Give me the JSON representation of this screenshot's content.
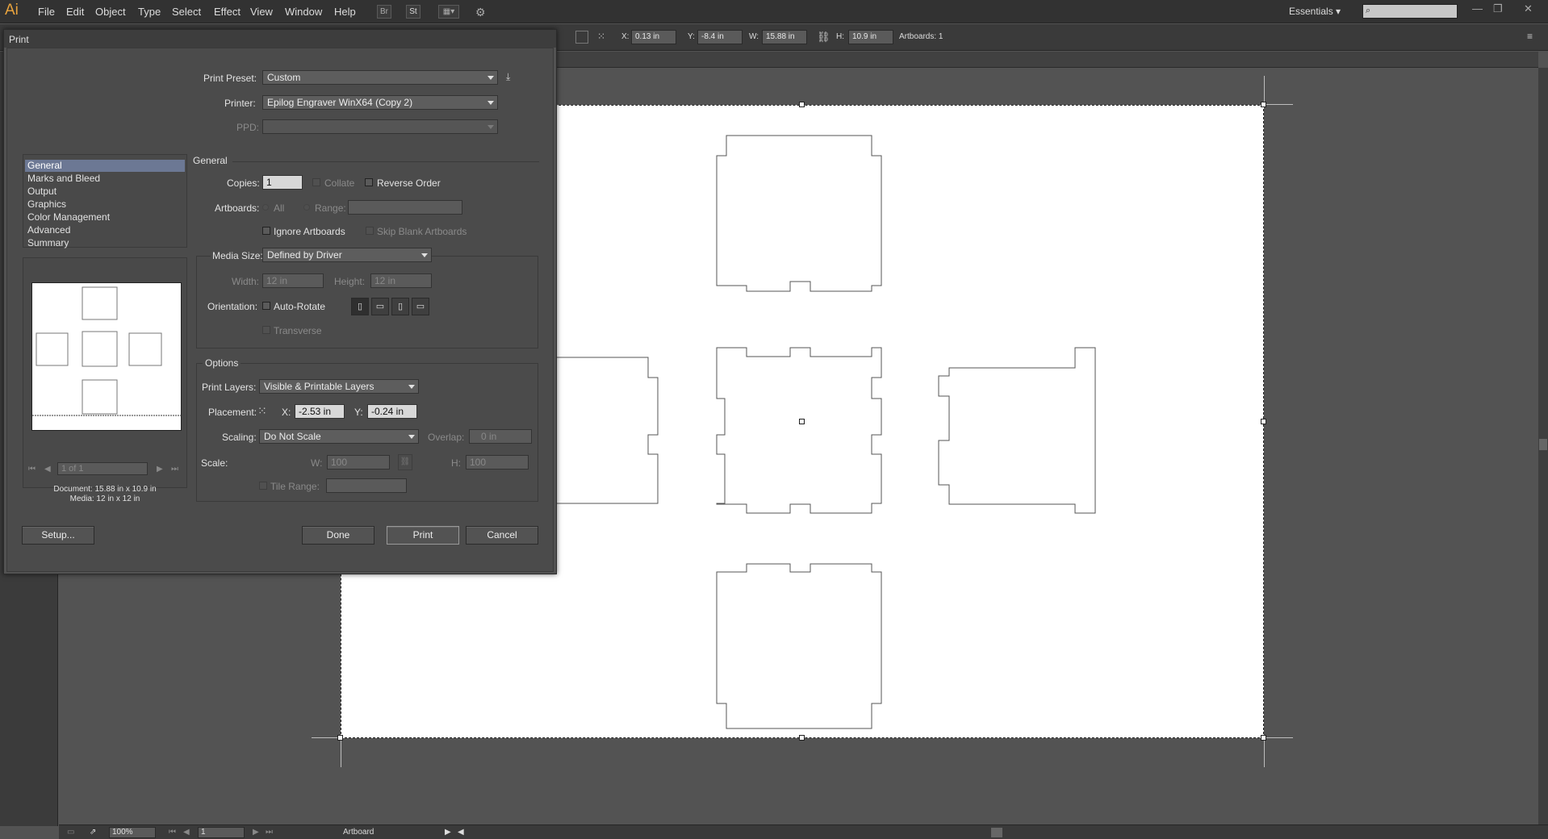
{
  "app": {
    "logo": "Ai"
  },
  "menu": [
    "File",
    "Edit",
    "Object",
    "Type",
    "Select",
    "Effect",
    "View",
    "Window",
    "Help"
  ],
  "toolbar_buttons": {
    "br": "Br",
    "st": "St"
  },
  "workspace": {
    "label": "Essentials",
    "caret": "▾"
  },
  "window_controls": {
    "minimize": "—",
    "restore": "❐",
    "close": "✕"
  },
  "controlbar": {
    "x_label": "X:",
    "x_value": "0.13 in",
    "y_label": "Y:",
    "y_value": "-8.4 in",
    "w_label": "W:",
    "w_value": "15.88 in",
    "h_label": "H:",
    "h_value": "10.9 in",
    "artboards": "Artboards: 1"
  },
  "statusbar": {
    "zoom": "100%",
    "artboard_num": "1",
    "artboard_label": "Artboard"
  },
  "dialog": {
    "title": "Print",
    "print_preset_label": "Print Preset:",
    "print_preset_value": "Custom",
    "printer_label": "Printer:",
    "printer_value": "Epilog Engraver WinX64 (Copy 2)",
    "ppd_label": "PPD:",
    "ppd_value": "",
    "categories": [
      "General",
      "Marks and Bleed",
      "Output",
      "Graphics",
      "Color Management",
      "Advanced",
      "Summary"
    ],
    "selected_category": "General",
    "preview": {
      "page_field": "1 of 1",
      "document_info": "Document: 15.88 in x 10.9 in",
      "media_info": "Media: 12 in x 12 in"
    },
    "general": {
      "section_title": "General",
      "copies_label": "Copies:",
      "copies_value": "1",
      "collate_label": "Collate",
      "reverse_order_label": "Reverse Order",
      "artboards_label": "Artboards:",
      "all_label": "All",
      "range_label": "Range:",
      "range_value": "",
      "ignore_artboards_label": "Ignore Artboards",
      "skip_blank_label": "Skip Blank Artboards",
      "media_size_label": "Media Size:",
      "media_size_value": "Defined by Driver",
      "width_label": "Width:",
      "width_value": "12 in",
      "height_label": "Height:",
      "height_value": "12 in",
      "orientation_label": "Orientation:",
      "auto_rotate_label": "Auto-Rotate",
      "transverse_label": "Transverse"
    },
    "options": {
      "section_title": "Options",
      "print_layers_label": "Print Layers:",
      "print_layers_value": "Visible & Printable Layers",
      "placement_label": "Placement:",
      "x_label": "X:",
      "x_value": "-2.53 in",
      "y_label": "Y:",
      "y_value": "-0.24 in",
      "scaling_label": "Scaling:",
      "scaling_value": "Do Not Scale",
      "overlap_label": "Overlap:",
      "overlap_value": "0 in",
      "scale_label": "Scale:",
      "w_label": "W:",
      "w_value": "100",
      "h_label": "H:",
      "h_value": "100",
      "tile_range_label": "Tile Range:",
      "tile_range_value": ""
    },
    "buttons": {
      "setup": "Setup...",
      "done": "Done",
      "print": "Print",
      "cancel": "Cancel"
    }
  }
}
